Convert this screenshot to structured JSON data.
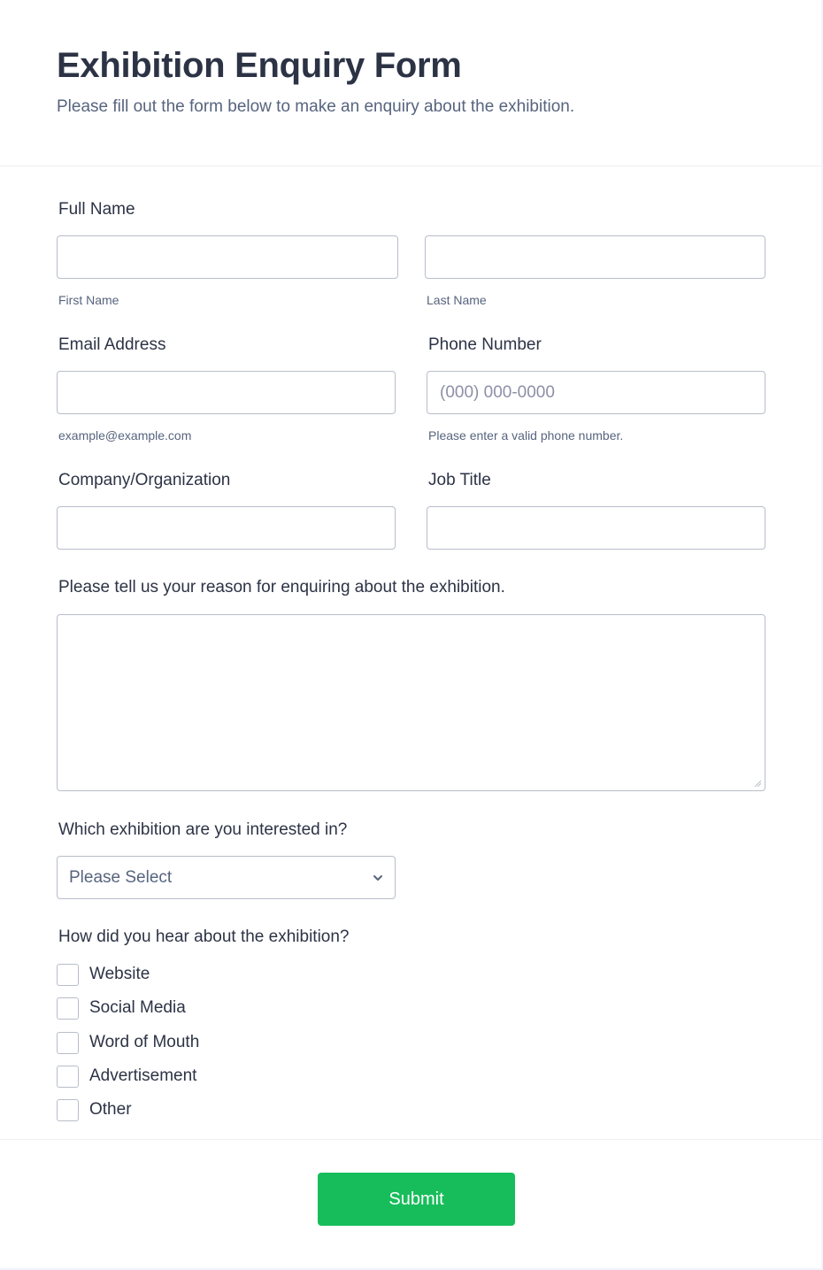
{
  "header": {
    "title": "Exhibition Enquiry Form",
    "subtitle": "Please fill out the form below to make an enquiry about the exhibition."
  },
  "fields": {
    "full_name": {
      "label": "Full Name",
      "first": {
        "value": "",
        "sublabel": "First Name"
      },
      "last": {
        "value": "",
        "sublabel": "Last Name"
      }
    },
    "email": {
      "label": "Email Address",
      "value": "",
      "sublabel": "example@example.com"
    },
    "phone": {
      "label": "Phone Number",
      "value": "",
      "placeholder": "(000) 000-0000",
      "sublabel": "Please enter a valid phone number."
    },
    "company": {
      "label": "Company/Organization",
      "value": ""
    },
    "job_title": {
      "label": "Job Title",
      "value": ""
    },
    "reason": {
      "label": "Please tell us your reason for enquiring about the exhibition.",
      "value": ""
    },
    "exhibition": {
      "label": "Which exhibition are you interested in?",
      "selected": "Please Select"
    },
    "source": {
      "label": "How did you hear about the exhibition?",
      "options": [
        {
          "label": "Website",
          "checked": false
        },
        {
          "label": "Social Media",
          "checked": false
        },
        {
          "label": "Word of Mouth",
          "checked": false
        },
        {
          "label": "Advertisement",
          "checked": false
        },
        {
          "label": "Other",
          "checked": false
        }
      ]
    }
  },
  "submit": {
    "label": "Submit",
    "color": "#18bd5b"
  }
}
